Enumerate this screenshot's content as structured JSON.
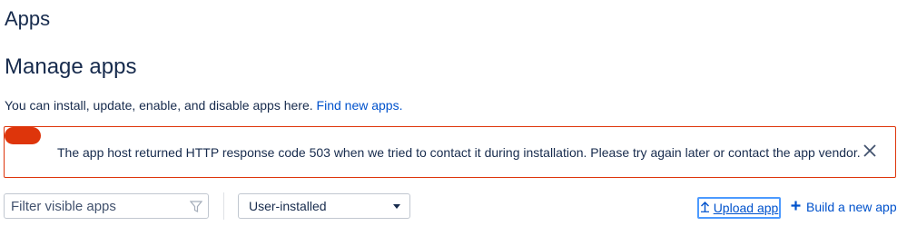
{
  "breadcrumb": {
    "label": "Apps"
  },
  "page": {
    "title": "Manage apps",
    "intro_text": "You can install, update, enable, and disable apps here.",
    "find_link": "Find new apps."
  },
  "error_banner": {
    "message": "The app host returned HTTP response code 503 when we tried to contact it during installation. Please try again later or contact the app vendor.",
    "close_icon": "close-icon",
    "accent_color": "#de350b"
  },
  "filter": {
    "placeholder": "Filter visible apps",
    "icon": "filter-icon"
  },
  "app_type_select": {
    "value": "User-installed"
  },
  "actions": {
    "upload_label": "Upload app",
    "upload_icon": "upload-icon",
    "build_label": "Build a new app",
    "build_icon": "plus-icon"
  },
  "colors": {
    "link": "#0052cc",
    "text": "#172b4d",
    "focus": "#4c9aff"
  }
}
